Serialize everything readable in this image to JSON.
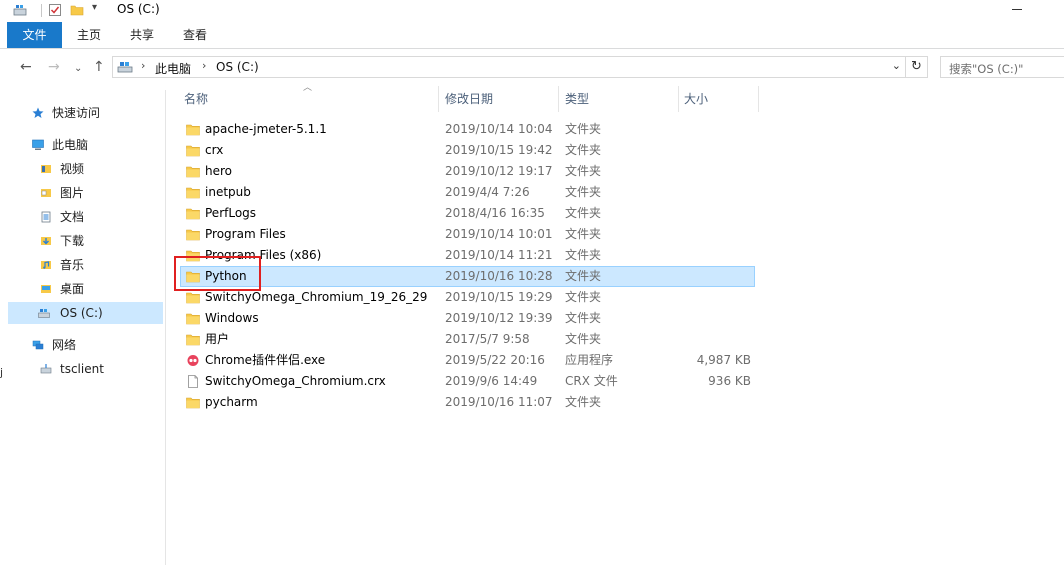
{
  "window": {
    "title": "OS (C:)"
  },
  "ribbon": {
    "tabs": [
      {
        "label": "文件"
      },
      {
        "label": "主页"
      },
      {
        "label": "共享"
      },
      {
        "label": "查看"
      }
    ]
  },
  "address": {
    "breadcrumb": [
      {
        "label": "此电脑"
      },
      {
        "label": "OS (C:)"
      }
    ],
    "search_placeholder": "搜索\"OS (C:)\""
  },
  "navpane": {
    "items": [
      {
        "label": "快速访问",
        "icon": "star-icon"
      },
      {
        "label": "此电脑",
        "icon": "computer-icon"
      },
      {
        "label": "视频",
        "icon": "video-folder-icon"
      },
      {
        "label": "图片",
        "icon": "pictures-folder-icon"
      },
      {
        "label": "文档",
        "icon": "documents-folder-icon"
      },
      {
        "label": "下载",
        "icon": "downloads-folder-icon"
      },
      {
        "label": "音乐",
        "icon": "music-folder-icon"
      },
      {
        "label": "桌面",
        "icon": "desktop-folder-icon"
      },
      {
        "label": "OS (C:)",
        "icon": "drive-icon"
      },
      {
        "label": "网络",
        "icon": "network-icon"
      },
      {
        "label": "tsclient",
        "icon": "network-drive-icon"
      }
    ],
    "selected": "OS (C:)"
  },
  "columns": {
    "name": "名称",
    "date": "修改日期",
    "type": "类型",
    "size": "大小"
  },
  "files": [
    {
      "name": "apache-jmeter-5.1.1",
      "date": "2019/10/14 10:04",
      "type": "文件夹",
      "size": "",
      "icon": "folder-icon"
    },
    {
      "name": "crx",
      "date": "2019/10/15 19:42",
      "type": "文件夹",
      "size": "",
      "icon": "folder-icon"
    },
    {
      "name": "hero",
      "date": "2019/10/12 19:17",
      "type": "文件夹",
      "size": "",
      "icon": "folder-icon"
    },
    {
      "name": "inetpub",
      "date": "2019/4/4 7:26",
      "type": "文件夹",
      "size": "",
      "icon": "folder-icon"
    },
    {
      "name": "PerfLogs",
      "date": "2018/4/16 16:35",
      "type": "文件夹",
      "size": "",
      "icon": "folder-icon"
    },
    {
      "name": "Program Files",
      "date": "2019/10/14 10:01",
      "type": "文件夹",
      "size": "",
      "icon": "folder-icon"
    },
    {
      "name": "Program Files (x86)",
      "date": "2019/10/14 11:21",
      "type": "文件夹",
      "size": "",
      "icon": "folder-icon"
    },
    {
      "name": "Python",
      "date": "2019/10/16 10:28",
      "type": "文件夹",
      "size": "",
      "icon": "folder-icon",
      "selected": true
    },
    {
      "name": "SwitchyOmega_Chromium_19_26_29",
      "date": "2019/10/15 19:29",
      "type": "文件夹",
      "size": "",
      "icon": "folder-icon"
    },
    {
      "name": "Windows",
      "date": "2019/10/12 19:39",
      "type": "文件夹",
      "size": "",
      "icon": "folder-icon"
    },
    {
      "name": "用户",
      "date": "2017/5/7 9:58",
      "type": "文件夹",
      "size": "",
      "icon": "folder-icon"
    },
    {
      "name": "Chrome插件伴侣.exe",
      "date": "2019/5/22 20:16",
      "type": "应用程序",
      "size": "4,987 KB",
      "icon": "app-icon"
    },
    {
      "name": "SwitchyOmega_Chromium.crx",
      "date": "2019/9/6 14:49",
      "type": "CRX 文件",
      "size": "936 KB",
      "icon": "file-icon"
    },
    {
      "name": "pycharm",
      "date": "2019/10/16 11:07",
      "type": "文件夹",
      "size": "",
      "icon": "folder-icon"
    }
  ],
  "colors": {
    "accent": "#1979ca",
    "selection": "#cce8ff",
    "selection_border": "#99d1ff",
    "folder": "#f7c948",
    "annotation": "#e02020"
  }
}
